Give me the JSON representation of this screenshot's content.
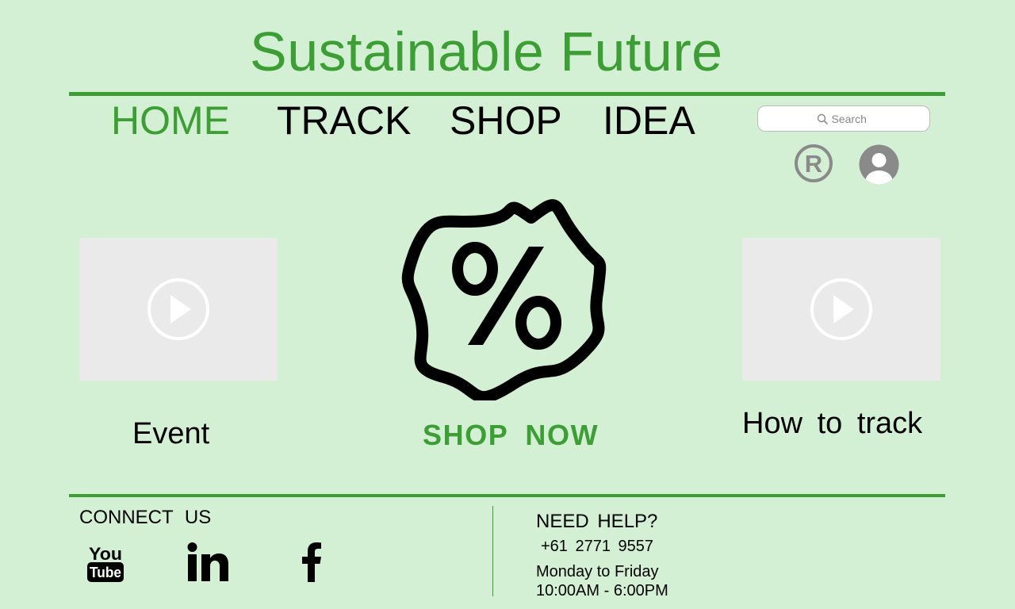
{
  "header": {
    "title": "Sustainable Future"
  },
  "nav": {
    "items": [
      {
        "label": "HOME",
        "active": true
      },
      {
        "label": "TRACK"
      },
      {
        "label": "SHOP"
      },
      {
        "label": "IDEA"
      }
    ]
  },
  "search": {
    "placeholder": "Search",
    "value": ""
  },
  "icons": {
    "account_icons": [
      "registered-icon",
      "user-avatar-icon"
    ],
    "hero": [
      "play-icon",
      "discount-percent-icon",
      "play-icon"
    ],
    "social": [
      "youtube-icon",
      "linkedin-icon",
      "facebook-icon"
    ]
  },
  "main": {
    "left_card": {
      "caption": "Event"
    },
    "center_promo": {
      "cta": "SHOP  NOW"
    },
    "right_card": {
      "caption": "How to track"
    }
  },
  "footer": {
    "connect": {
      "title": "CONNECT  US"
    },
    "help": {
      "title": "NEED  HELP?",
      "phone": "+61 2771  9557",
      "days": "Monday to  Friday",
      "hours": "10:00AM - 6:00PM"
    }
  },
  "colors": {
    "background": "#d4f0d4",
    "accent": "#3c9e34",
    "placeholder_card": "#eaeaea",
    "icon_gray": "#888888"
  }
}
